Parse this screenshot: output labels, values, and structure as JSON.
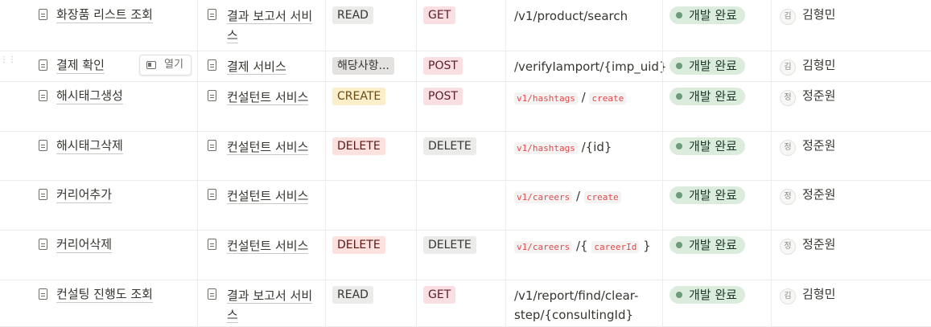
{
  "rows": [
    {
      "name": "화장품 리스트 조회",
      "service": "결과 보고서 서비스",
      "crud": {
        "label": "READ",
        "style": "read"
      },
      "method": {
        "label": "GET",
        "style": "get"
      },
      "endpoint": {
        "type": "text",
        "text": "/v1/product/search"
      },
      "status": "개발 완료",
      "assignee": {
        "initial": "김",
        "name": "김형민"
      }
    },
    {
      "name": "결제 확인",
      "service": "결제 서비스",
      "crud": {
        "label": "해당사항...",
        "style": "na"
      },
      "method": {
        "label": "POST",
        "style": "post"
      },
      "endpoint": {
        "type": "text",
        "text": "/verifyIamport/{imp_uid}"
      },
      "status": "개발 완료",
      "assignee": {
        "initial": "김",
        "name": "김형민"
      }
    },
    {
      "name": "해시태그생성",
      "service": "컨설턴트 서비스",
      "crud": {
        "label": "CREATE",
        "style": "create"
      },
      "method": {
        "label": "POST",
        "style": "post"
      },
      "endpoint": {
        "type": "parts",
        "parts": [
          {
            "code": "v1/hashtags"
          },
          {
            "text": " / "
          },
          {
            "code": "create"
          }
        ]
      },
      "status": "개발 완료",
      "assignee": {
        "initial": "정",
        "name": "정준원"
      }
    },
    {
      "name": "해시태그삭제",
      "service": "컨설턴트 서비스",
      "crud": {
        "label": "DELETE",
        "style": "delete"
      },
      "method": {
        "label": "DELETE",
        "style": "del2"
      },
      "endpoint": {
        "type": "parts",
        "parts": [
          {
            "code": "v1/hashtags"
          },
          {
            "text": " /{id}"
          }
        ]
      },
      "status": "개발 완료",
      "assignee": {
        "initial": "정",
        "name": "정준원"
      }
    },
    {
      "name": "커리어추가",
      "service": "컨설턴트 서비스",
      "crud": null,
      "method": null,
      "endpoint": {
        "type": "parts",
        "parts": [
          {
            "code": "v1/careers"
          },
          {
            "text": " / "
          },
          {
            "code": "create"
          }
        ]
      },
      "status": "개발 완료",
      "assignee": {
        "initial": "정",
        "name": "정준원"
      }
    },
    {
      "name": "커리어삭제",
      "service": "컨설턴트 서비스",
      "crud": {
        "label": "DELETE",
        "style": "delete"
      },
      "method": {
        "label": "DELETE",
        "style": "del2"
      },
      "endpoint": {
        "type": "parts",
        "parts": [
          {
            "code": "v1/careers"
          },
          {
            "text": " /{ "
          },
          {
            "code": "careerId"
          },
          {
            "text": " }"
          }
        ]
      },
      "status": "개발 완료",
      "assignee": {
        "initial": "정",
        "name": "정준원"
      }
    },
    {
      "name": "컨설팅 진행도 조회",
      "service": "결과 보고서 서비스",
      "crud": {
        "label": "READ",
        "style": "read"
      },
      "method": {
        "label": "GET",
        "style": "get"
      },
      "endpoint": {
        "type": "text",
        "text": "/v1/report/find/clear-step/{consultingId}"
      },
      "status": "개발 완료",
      "assignee": {
        "initial": "김",
        "name": "김형민"
      }
    }
  ],
  "open_button": {
    "label": "열기",
    "icon": "open-panel-icon"
  },
  "colors": {
    "status_bg": "#dbecdc",
    "status_dot": "#6c9b7d",
    "code_text": "#e5484d"
  }
}
